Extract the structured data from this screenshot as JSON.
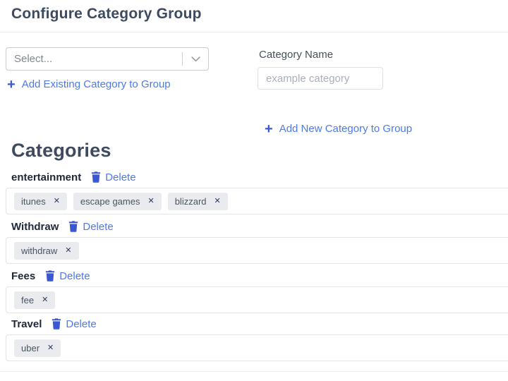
{
  "page": {
    "title": "Configure Category Group",
    "section_heading": "Categories"
  },
  "form": {
    "select_placeholder": "Select...",
    "add_existing_label": "Add Existing Category to Group",
    "category_name_label": "Category Name",
    "category_name_placeholder": "example category",
    "category_name_value": "",
    "add_new_label": "Add New Category to Group"
  },
  "icons": {
    "plus_glyph": "+",
    "remove_tag_glyph": "✕",
    "chevron_down": "v",
    "trash": "trash-can"
  },
  "colors": {
    "heading": "#3d4a5f",
    "link_text": "#4d79ea",
    "icon_blue": "#3b57d2",
    "chip_bg": "#e9ebee",
    "chip_text": "#4a5468",
    "chip_remove": "#2c3b5e",
    "border_light": "#e3e5e9"
  },
  "categories": [
    {
      "name": "entertainment",
      "delete_label": "Delete",
      "tags": [
        "itunes",
        "escape games",
        "blizzard"
      ]
    },
    {
      "name": "Withdraw",
      "delete_label": "Delete",
      "tags": [
        "withdraw"
      ]
    },
    {
      "name": "Fees",
      "delete_label": "Delete",
      "tags": [
        "fee"
      ]
    },
    {
      "name": "Travel",
      "delete_label": "Delete",
      "tags": [
        "uber"
      ]
    }
  ]
}
